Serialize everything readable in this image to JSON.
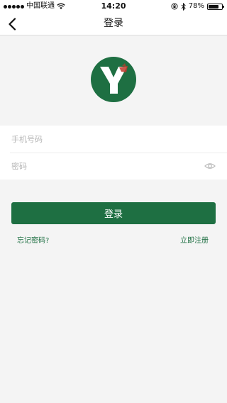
{
  "status_bar": {
    "carrier": "中国联通",
    "time": "14:20",
    "battery_text": "78%",
    "battery_level": 0.78
  },
  "nav": {
    "title": "登录"
  },
  "form": {
    "phone_placeholder": "手机号码",
    "password_placeholder": "密码"
  },
  "actions": {
    "login_label": "登录",
    "forgot_label": "忘记密码?",
    "register_label": "立即注册"
  },
  "colors": {
    "brand": "#1e6f42",
    "accent": "#c0392b"
  }
}
